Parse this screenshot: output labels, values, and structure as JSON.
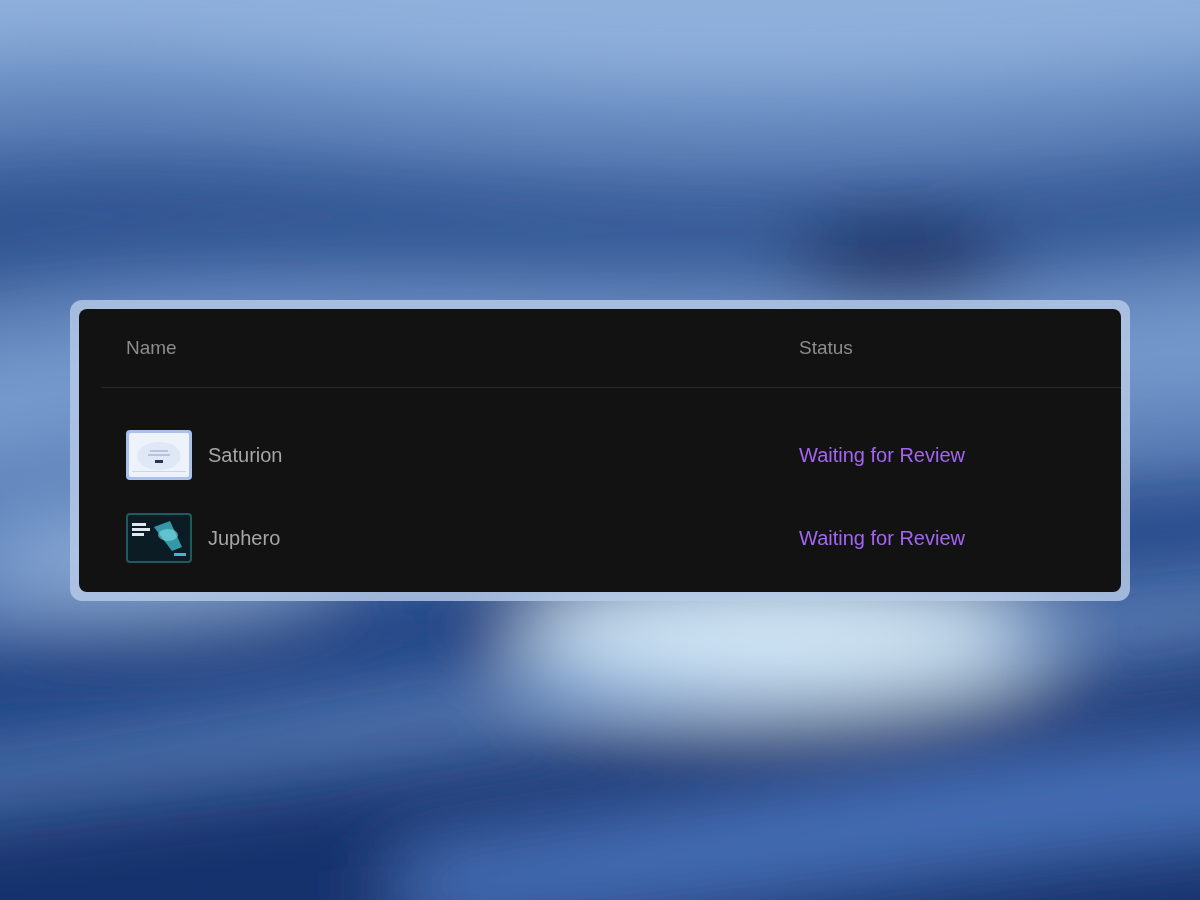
{
  "table": {
    "columns": [
      "Name",
      "Status"
    ],
    "rows": [
      {
        "name": "Saturion",
        "status": "Waiting for Review"
      },
      {
        "name": "Juphero",
        "status": "Waiting for Review"
      }
    ]
  }
}
